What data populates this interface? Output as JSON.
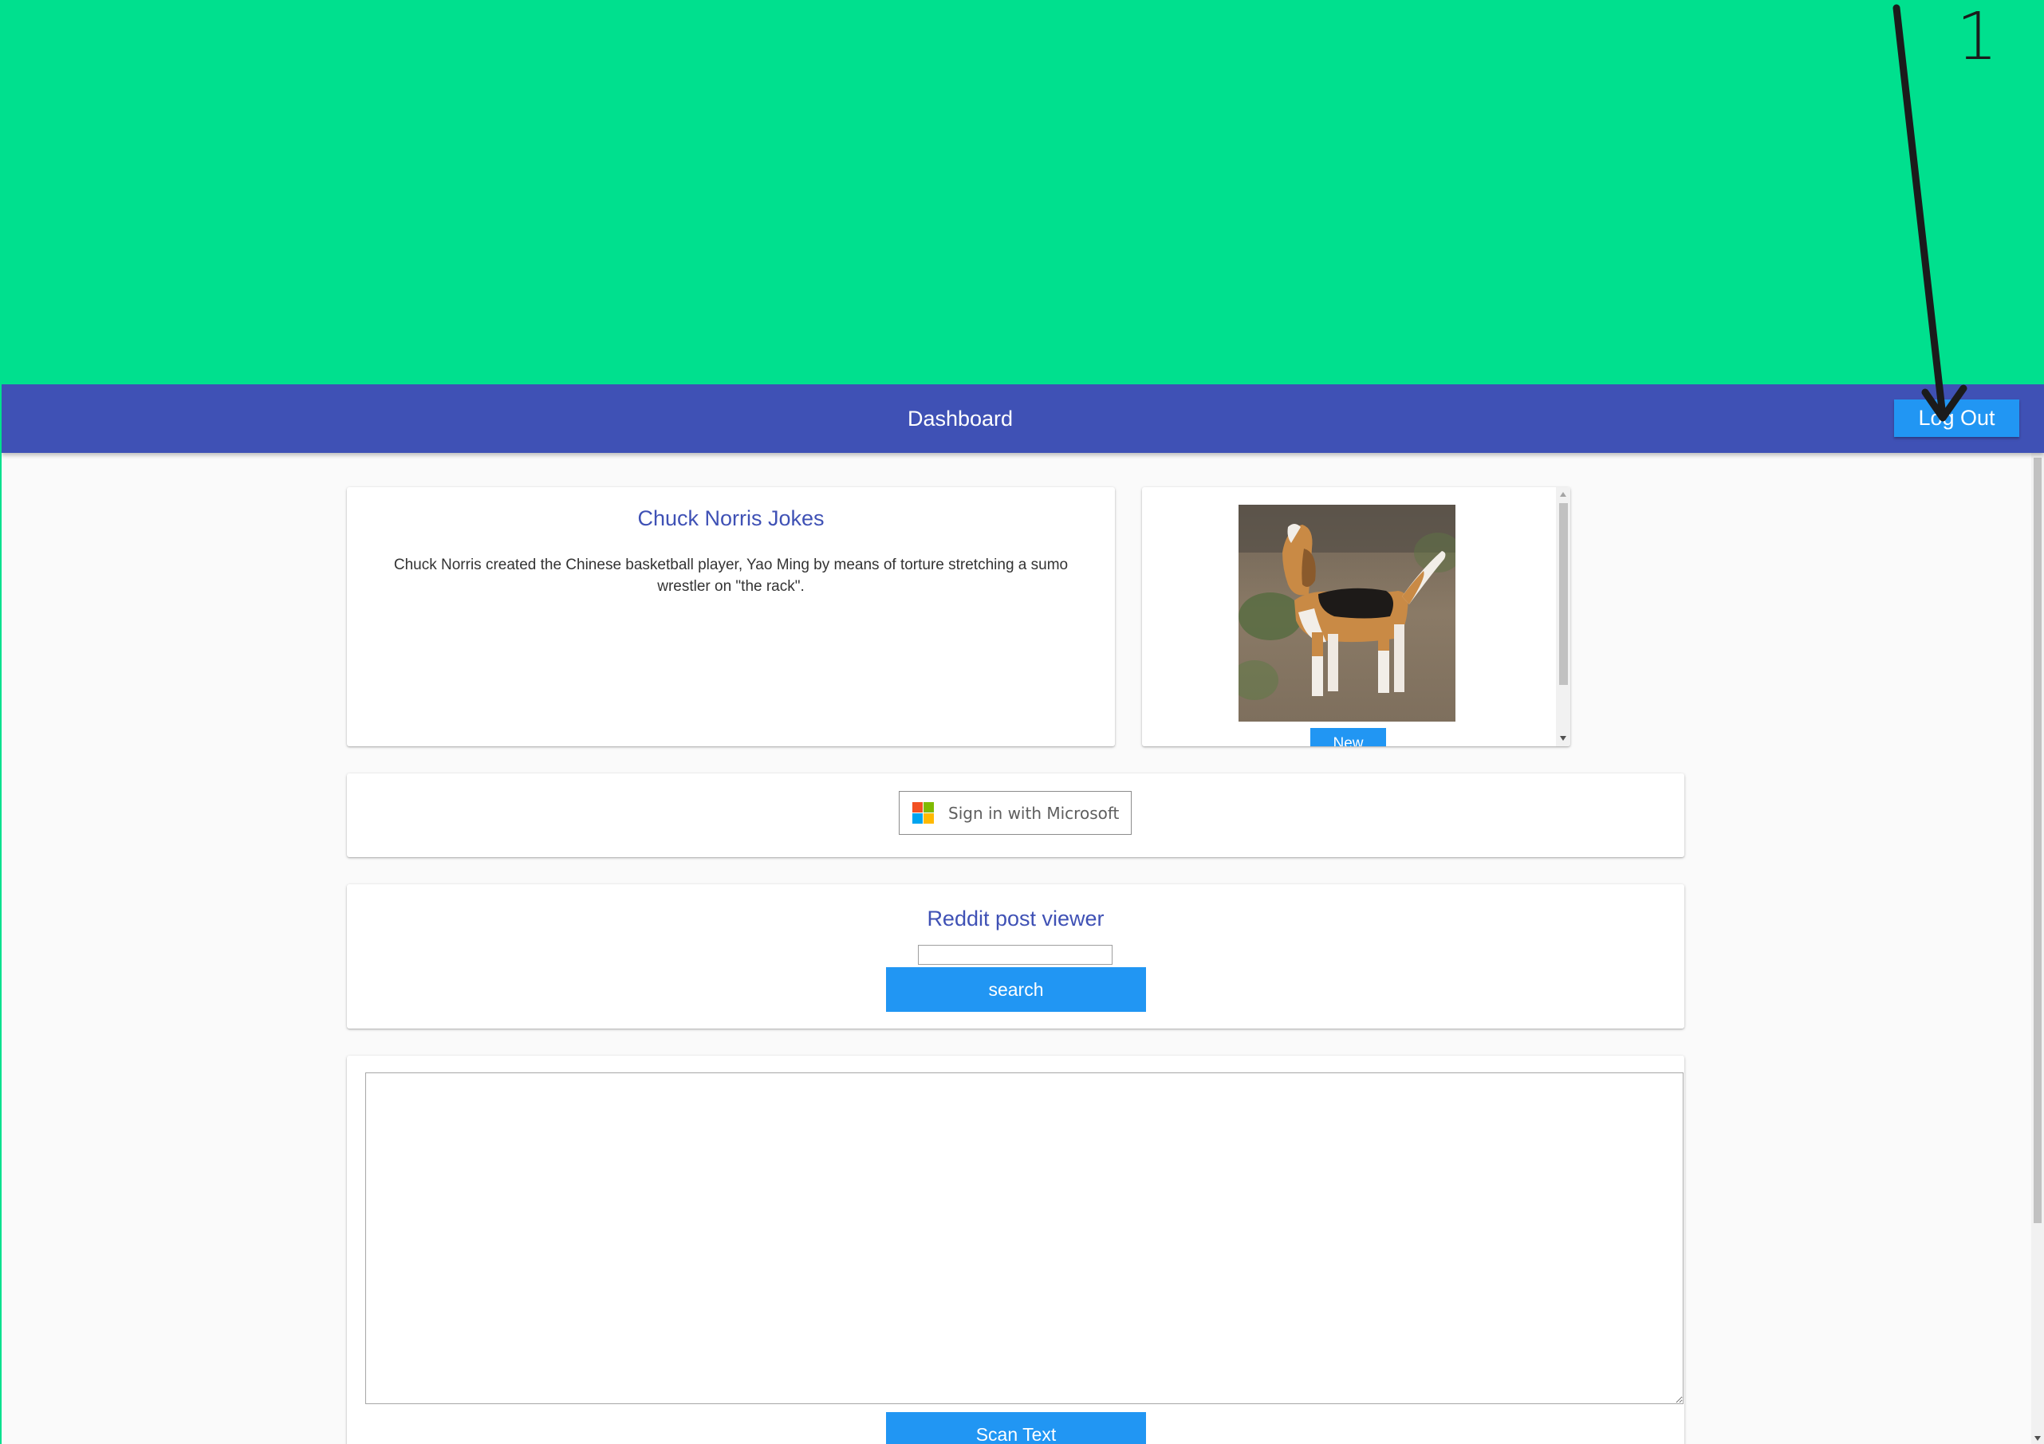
{
  "annotation": {
    "step_number": "1",
    "color": "#1b1b1b"
  },
  "appbar": {
    "title": "Dashboard",
    "logout_label": "Log Out",
    "background": "#3f51b5"
  },
  "jokes": {
    "title": "Chuck Norris Jokes",
    "text": "Chuck Norris created the Chinese basketball player, Yao Ming by means of torture stretching a sumo wrestler on \"the rack\"."
  },
  "dog": {
    "image_alt": "Beagle",
    "new_label": "New"
  },
  "microsoft": {
    "sign_in_label": "Sign in with Microsoft"
  },
  "reddit": {
    "title": "Reddit post viewer",
    "input_value": "",
    "search_label": "search"
  },
  "scan": {
    "textarea_value": "",
    "scan_label": "Scan Text"
  },
  "colors": {
    "accent": "#2196f3",
    "primary": "#3f51b5",
    "background": "#00e08e"
  }
}
